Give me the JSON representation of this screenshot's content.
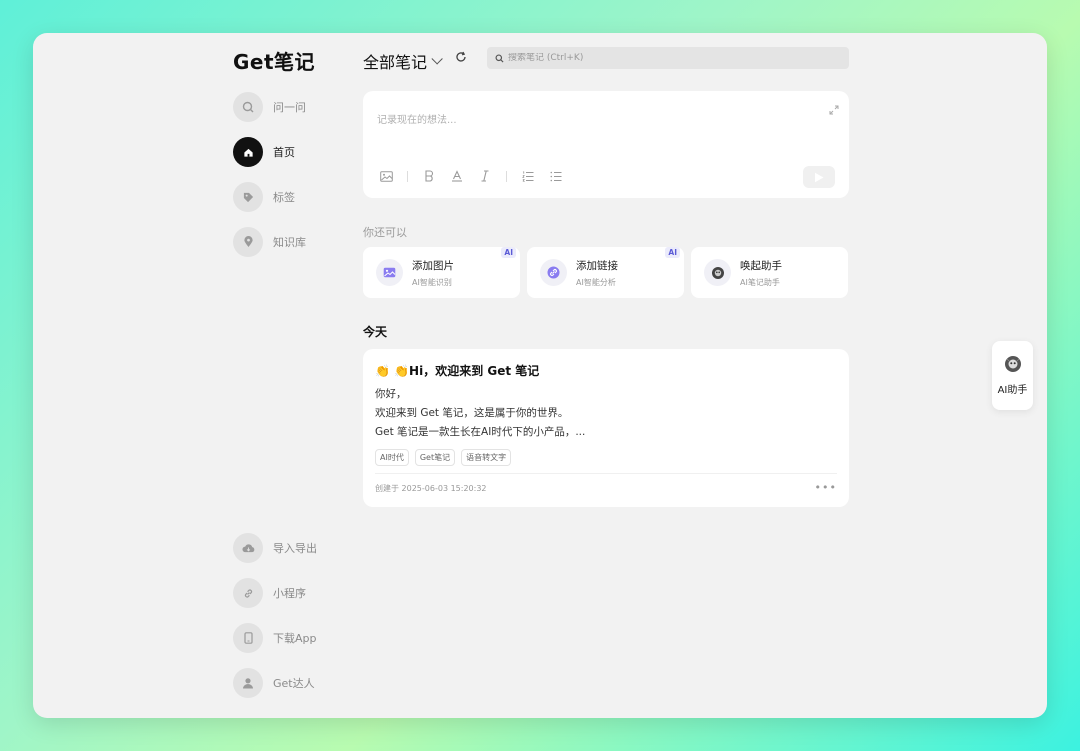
{
  "app": {
    "logo": "Get笔记"
  },
  "sidebar": {
    "top_items": [
      {
        "label": "问一问",
        "icon": "ask-icon"
      },
      {
        "label": "首页",
        "icon": "home-icon"
      },
      {
        "label": "标签",
        "icon": "tag-icon"
      },
      {
        "label": "知识库",
        "icon": "knowledge-icon"
      }
    ],
    "bottom_items": [
      {
        "label": "导入导出",
        "icon": "cloud-icon"
      },
      {
        "label": "小程序",
        "icon": "link-icon"
      },
      {
        "label": "下载App",
        "icon": "phone-icon"
      },
      {
        "label": "Get达人",
        "icon": "user-icon"
      }
    ]
  },
  "header": {
    "title": "全部笔记",
    "search_placeholder": "搜索笔记 (Ctrl+K)"
  },
  "editor": {
    "placeholder": "记录现在的想法...",
    "tools": [
      "image-icon",
      "bold-icon",
      "text-color-icon",
      "italic-icon",
      "ordered-list-icon",
      "bullet-list-icon"
    ]
  },
  "suggestions": {
    "hint": "你还可以",
    "cards": [
      {
        "title": "添加图片",
        "subtitle": "AI智能识别",
        "badge": "AI",
        "icon": "image-icon"
      },
      {
        "title": "添加链接",
        "subtitle": "AI智能分析",
        "badge": "AI",
        "icon": "link-icon"
      },
      {
        "title": "唤起助手",
        "subtitle": "AI笔记助手",
        "badge": "",
        "icon": "assistant-icon"
      }
    ]
  },
  "today": {
    "heading": "今天",
    "note": {
      "title": "👏 👏Hi，欢迎来到 Get 笔记",
      "lines": [
        "你好，",
        "欢迎来到 Get 笔记，这是属于你的世界。",
        "Get 笔记是一款生长在AI时代下的小产品，..."
      ],
      "tags": [
        "AI时代",
        "Get笔记",
        "语音转文字"
      ],
      "created": "创建于 2025-06-03 15:20:32",
      "more": "•••"
    }
  },
  "assistant": {
    "label": "AI助手"
  }
}
